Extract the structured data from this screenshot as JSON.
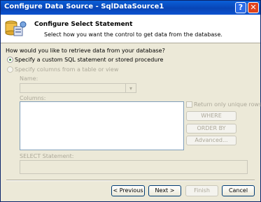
{
  "window": {
    "title": "Configure Data Source - SqlDataSource1"
  },
  "titlebar_buttons": {
    "help_label": "?",
    "close_label": "✕"
  },
  "header": {
    "title": "Configure Select Statement",
    "subtitle": "Select how you want the control to get data from the database."
  },
  "question": "How would you like to retrieve data from your database?",
  "options": {
    "custom_sql": {
      "label": "Specify a custom SQL statement or stored procedure",
      "selected": true
    },
    "table_view": {
      "label": "Specify columns from a table or view",
      "selected": false
    }
  },
  "name_label": "Name:",
  "columns_label": "Columns:",
  "unique_rows_label": "Return only unique rows",
  "side_buttons": {
    "where": "WHERE",
    "order_by": "ORDER BY",
    "advanced": "Advanced..."
  },
  "select_statement_label": "SELECT Statement:",
  "footer_buttons": {
    "previous": "< Previous",
    "next": "Next >",
    "finish": "Finish",
    "cancel": "Cancel"
  }
}
